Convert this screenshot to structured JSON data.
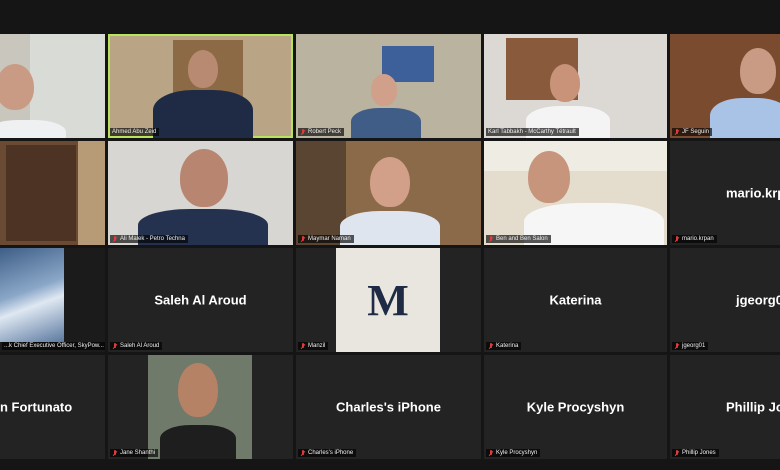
{
  "participants": [
    {
      "label": "",
      "display_name": ""
    },
    {
      "label": "Ahmed Abu Zeid",
      "display_name": ""
    },
    {
      "label": "Robert Peck",
      "display_name": ""
    },
    {
      "label": "Karl Tabbakh - McCarthy Tétrault",
      "display_name": ""
    },
    {
      "label": "JF Seguin",
      "display_name": ""
    },
    {
      "label": "",
      "display_name": ""
    },
    {
      "label": "Ali Malek - Petro Techna",
      "display_name": ""
    },
    {
      "label": "Maymar Naman",
      "display_name": ""
    },
    {
      "label": "Ben and Ben Salon",
      "display_name": ""
    },
    {
      "label": "mario.krpan",
      "display_name": "mario.krp"
    },
    {
      "label": "...k Chief Executive Officer, SkyPow...",
      "display_name": ""
    },
    {
      "label": "Saleh Al Aroud",
      "display_name": "Saleh Al Aroud"
    },
    {
      "label": "Manzil",
      "display_name": ""
    },
    {
      "label": "Katerina",
      "display_name": "Katerina"
    },
    {
      "label": "jgeorg01",
      "display_name": "jgeorg0"
    },
    {
      "label": "",
      "display_name": "n Fortunato"
    },
    {
      "label": "Jane Shanthi",
      "display_name": ""
    },
    {
      "label": "Charles's iPhone",
      "display_name": "Charles's iPhone"
    },
    {
      "label": "Kyle Procyshyn",
      "display_name": "Kyle Procyshyn"
    },
    {
      "label": "Phillip Jones",
      "display_name": "Phillip Jo"
    }
  ],
  "manzil_logo": "M",
  "colors": {
    "active_speaker": "#b8e35c",
    "muted_icon": "#e03a3a",
    "tile_bg": "#232323",
    "background": "#151515"
  }
}
